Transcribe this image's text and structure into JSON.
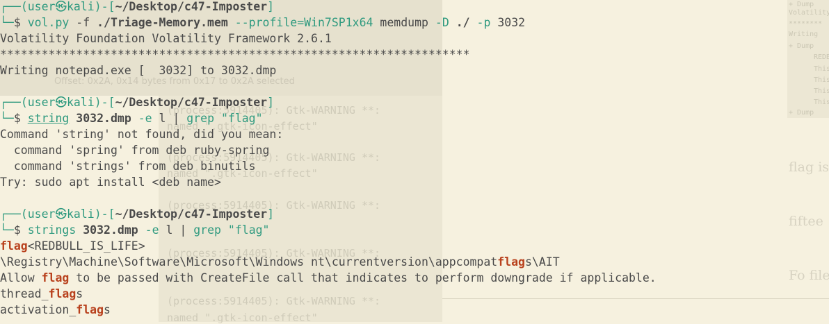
{
  "prompt": {
    "corner_top": "┌──",
    "corner_bottom": "└─",
    "user": "user",
    "skull": "㉿",
    "host": "kali",
    "sep": ")-[",
    "path": "~/Desktop/c47-Imposter",
    "close": "]",
    "dollar": "$"
  },
  "blocks": [
    {
      "command": {
        "program": "vol.py",
        "args": [
          {
            "t": " -f ",
            "s": "dim"
          },
          {
            "t": "./Triage-Memory.mem",
            "s": "bold"
          },
          {
            "t": " --profile=Win7SP1x64",
            "s": "green"
          },
          {
            "t": " memdump",
            "s": "dim"
          },
          {
            "t": " -D",
            "s": "green"
          },
          {
            "t": " ./",
            "s": "bold"
          },
          {
            "t": " -p",
            "s": "green"
          },
          {
            "t": " 3032",
            "s": "dim"
          }
        ]
      },
      "output": [
        "Volatility Foundation Volatility Framework 2.6.1",
        "********************************************************************",
        "Writing notepad.exe [  3032] to 3032.dmp"
      ]
    },
    {
      "command": {
        "program": "string",
        "args": [
          {
            "t": " 3032.dmp",
            "s": "bold"
          },
          {
            "t": " -e",
            "s": "green"
          },
          {
            "t": " l",
            "s": "dim"
          },
          {
            "t": " | ",
            "s": "dim"
          },
          {
            "t": "grep",
            "s": "green"
          },
          {
            "t": " \"flag\"",
            "s": "green"
          }
        ]
      },
      "output": [
        "Command 'string' not found, did you mean:",
        "  command 'spring' from deb ruby-spring",
        "  command 'strings' from deb binutils",
        "Try: sudo apt install <deb name>"
      ]
    },
    {
      "command": {
        "program": "strings",
        "args": [
          {
            "t": " 3032.dmp",
            "s": "bold"
          },
          {
            "t": " -e",
            "s": "green"
          },
          {
            "t": " l",
            "s": "dim"
          },
          {
            "t": " | ",
            "s": "dim"
          },
          {
            "t": "grep",
            "s": "green"
          },
          {
            "t": " \"flag\"",
            "s": "green"
          }
        ]
      },
      "grep_results": [
        [
          "",
          "flag",
          "<REDBULL_IS_LIFE>"
        ],
        [
          "\\Registry\\Machine\\Software\\Microsoft\\Windows nt\\currentversion\\appcompat",
          "flag",
          "s\\AIT"
        ],
        [
          "Allow ",
          "flag",
          " to be passed with CreateFile call that indicates to perform downgrade if applicable."
        ],
        [
          "thread_",
          "flag",
          "s"
        ],
        [
          "activation_",
          "flag",
          "s"
        ]
      ]
    }
  ],
  "background_ghosts": {
    "offset_text": "Offset: 0x2A, 0x14 bytes from 0x17 to 0x2A selected",
    "gtk_lines": [
      "(process:5914405): Gtk-WARNING **:",
      "named \".gtk-icon-effect\"",
      "(process:5914405): Gtk-WARNING **:",
      "named \".gtk-icon-effect\"",
      "(process:5914405): Gtk-WARNING **:",
      "(process:5914405): Gtk-WARNING **:",
      "(process:5914405): Gtk-WARNING **:",
      "named \".gtk-icon-effect\""
    ],
    "doc_words": [
      "flag is",
      "fiftee",
      "Fo file"
    ],
    "mini_lines": [
      "+ Dump",
      "Volatility",
      "********",
      "Writing",
      "+ Dump",
      "REDB",
      "This",
      "This",
      "This",
      "This",
      "+ Dump"
    ]
  }
}
